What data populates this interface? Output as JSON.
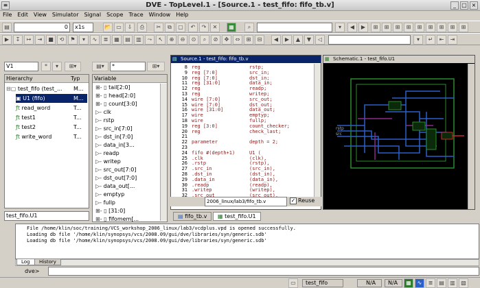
{
  "window": {
    "title": "DVE - TopLevel.1 - [Source.1 - test_fifo: fifo_tb.v]"
  },
  "menu": [
    "File",
    "Edit",
    "View",
    "Simulator",
    "Signal",
    "Scope",
    "Trace",
    "Window",
    "Help"
  ],
  "toolbar": {
    "time_value": "0",
    "time_unit": "x1s"
  },
  "hier": {
    "scope_select": "V1",
    "col_hierarchy": "Hierarchy",
    "col_type": "Typ",
    "items": [
      {
        "name": "test_fifo (test_...",
        "type": "M..."
      },
      {
        "name": "U1 (fifo)",
        "type": "M..."
      },
      {
        "name": "read_word",
        "type": "T..."
      },
      {
        "name": "test1",
        "type": "T..."
      },
      {
        "name": "test2",
        "type": "T..."
      },
      {
        "name": "write_word",
        "type": "T..."
      }
    ],
    "footer": "test_fifo.U1"
  },
  "vars": {
    "col": "Variable",
    "items": [
      "tail[2:0]",
      "head[2:0]",
      "count[3:0]",
      "clk",
      "rstp",
      "src_in[7:0]",
      "dst_in[7:0]",
      "data_in[3...",
      "readp",
      "writep",
      "src_out[7:0]",
      "dst_out[7:0]",
      "data_out[...",
      "emptyp",
      "fullp",
      "[31:0]",
      "fifomem[..."
    ]
  },
  "source": {
    "title": "Source.1 - test_fifo: fifo_tb.v",
    "lines": [
      {
        "n": "8",
        "k": "reg",
        "rest": "rstp;"
      },
      {
        "n": "9",
        "k": "reg [7:0]",
        "rest": "src_in;"
      },
      {
        "n": "10",
        "k": "reg [7:0]",
        "rest": "dst_in;"
      },
      {
        "n": "11",
        "k": "reg [31:0]",
        "rest": "data_in;"
      },
      {
        "n": "12",
        "k": "reg",
        "rest": "readp;"
      },
      {
        "n": "13",
        "k": "reg",
        "rest": "writep;"
      },
      {
        "n": "14",
        "k": "wire [7:0]",
        "rest": "src_out;"
      },
      {
        "n": "15",
        "k": "wire [7:0]",
        "rest": "dst_out;"
      },
      {
        "n": "16",
        "k": "wire [31:0]",
        "rest": "data_out;"
      },
      {
        "n": "17",
        "k": "wire",
        "rest": "emptyp;"
      },
      {
        "n": "18",
        "k": "wire",
        "rest": "fullp;"
      },
      {
        "n": "19",
        "k": "reg [3:0]",
        "rest": "count_checker;"
      },
      {
        "n": "20",
        "k": "reg",
        "rest": "check_last;"
      },
      {
        "n": "21",
        "k": "",
        "rest": ""
      },
      {
        "n": "22",
        "k": "parameter",
        "rest": "depth = 2;"
      },
      {
        "n": "23",
        "k": "",
        "rest": ""
      },
      {
        "n": "24",
        "k": "fifo #(depth+1)",
        "rest": "U1 ("
      },
      {
        "n": "25",
        "k": ".clk",
        "rest": "(clk),"
      },
      {
        "n": "26",
        "k": ".rstp",
        "rest": "(rstp),"
      },
      {
        "n": "27",
        "k": ".src_in",
        "rest": "(src_in),"
      },
      {
        "n": "28",
        "k": ".dst_in",
        "rest": "(dst_in),"
      },
      {
        "n": "29",
        "k": ".data_in",
        "rest": "(data_in),"
      },
      {
        "n": "30",
        "k": ".readp",
        "rest": "(readp),"
      },
      {
        "n": "31",
        "k": ".writep",
        "rest": "(writep),"
      },
      {
        "n": "32",
        "k": ".src_out",
        "rest": "(src_out),"
      }
    ],
    "path": "2006_linux/lab3/fifo_tb.v",
    "reuse": "Reuse"
  },
  "schematic": {
    "title": "Schematic.1 - test_fifo.U1"
  },
  "tabs": [
    "fifo_tb.v",
    "test_fifo.U1"
  ],
  "console": {
    "lines": [
      "File /home/klin/soc/training/VCS_workshop_2006_linux/lab3/vcdplus.vpd is opened successfully.",
      "Loading db file '/home/klin/synopsys/vcs/2008.09/gui/dve/libraries/syn/generic.sdb'",
      "Loading db file '/home/klin/synopsys/vcs/2008.09/gui/dve/libraries/syn/generic.sdb'"
    ],
    "tabs": [
      "Log",
      "History"
    ],
    "prompt": "dve>"
  },
  "status": {
    "scope": "test_fifo",
    "a": "N/A",
    "b": "N/A"
  }
}
